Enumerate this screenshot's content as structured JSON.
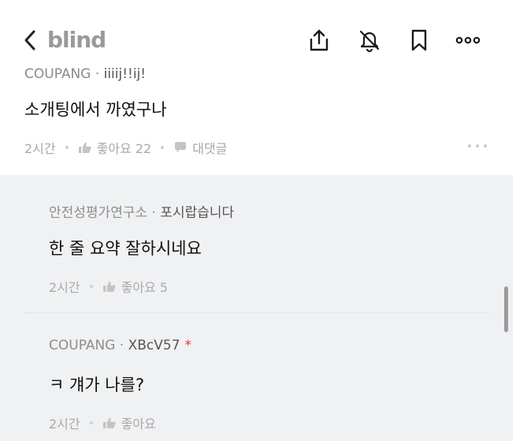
{
  "header": {
    "back_label": "Back",
    "logo": "blind",
    "icons": [
      "share-icon",
      "bell-off-icon",
      "bookmark-icon",
      "more-icon"
    ]
  },
  "post": {
    "company": "COUPANG",
    "separator": " · ",
    "nickname": "iiiij!!ij!",
    "content": "소개팅에서 까였구나",
    "time": "2시간",
    "like_label": "좋아요 22",
    "comment_label": "대댓글"
  },
  "comments": [
    {
      "company": "안전성평가연구소",
      "nickname": "포시랍습니다",
      "content": "한 줄 요약 잘하시네요",
      "time": "2시간",
      "like_label": "좋아요 5",
      "is_author": false
    },
    {
      "company": "COUPANG",
      "nickname": "XBcV57",
      "author_mark": "*",
      "content": "ㅋ 걔가 나를?",
      "time": "2시간",
      "like_label": "좋아요",
      "is_author": true
    }
  ],
  "colors": {
    "accent_red": "#e53935",
    "comment_bg": "#f0f1f3",
    "muted_text": "#8a8a8a"
  }
}
